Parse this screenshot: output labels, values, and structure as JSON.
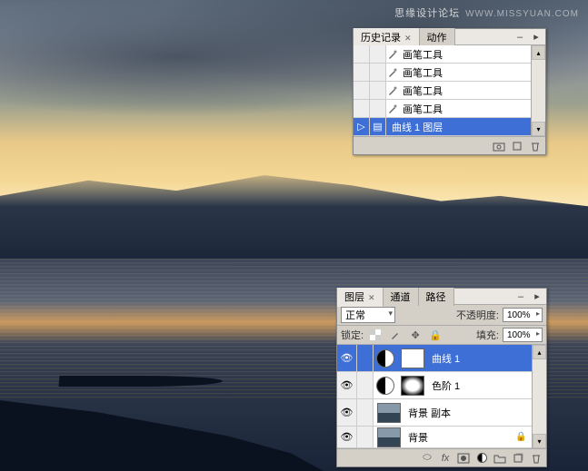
{
  "watermark": {
    "text1": "思缘设计论坛",
    "text2": "WWW.MISSYUAN.COM"
  },
  "history_panel": {
    "tabs": {
      "history": "历史记录",
      "actions": "动作"
    },
    "items": [
      {
        "name": "画笔工具",
        "icon": "brush"
      },
      {
        "name": "画笔工具",
        "icon": "brush"
      },
      {
        "name": "画笔工具",
        "icon": "brush"
      },
      {
        "name": "画笔工具",
        "icon": "brush"
      },
      {
        "name": "曲线 1 图层",
        "icon": "layer",
        "selected": true
      }
    ]
  },
  "layers_panel": {
    "tabs": {
      "layers": "图层",
      "channels": "通道",
      "paths": "路径"
    },
    "blend_mode": "正常",
    "opacity_label": "不透明度:",
    "opacity_value": "100%",
    "lock_label": "锁定:",
    "fill_label": "填充:",
    "fill_value": "100%",
    "layers": [
      {
        "name": "曲线 1",
        "type": "adjustment",
        "selected": true
      },
      {
        "name": "色阶 1",
        "type": "adjustment"
      },
      {
        "name": "背景 副本",
        "type": "image"
      },
      {
        "name": "背景",
        "type": "image",
        "locked": true
      }
    ]
  }
}
